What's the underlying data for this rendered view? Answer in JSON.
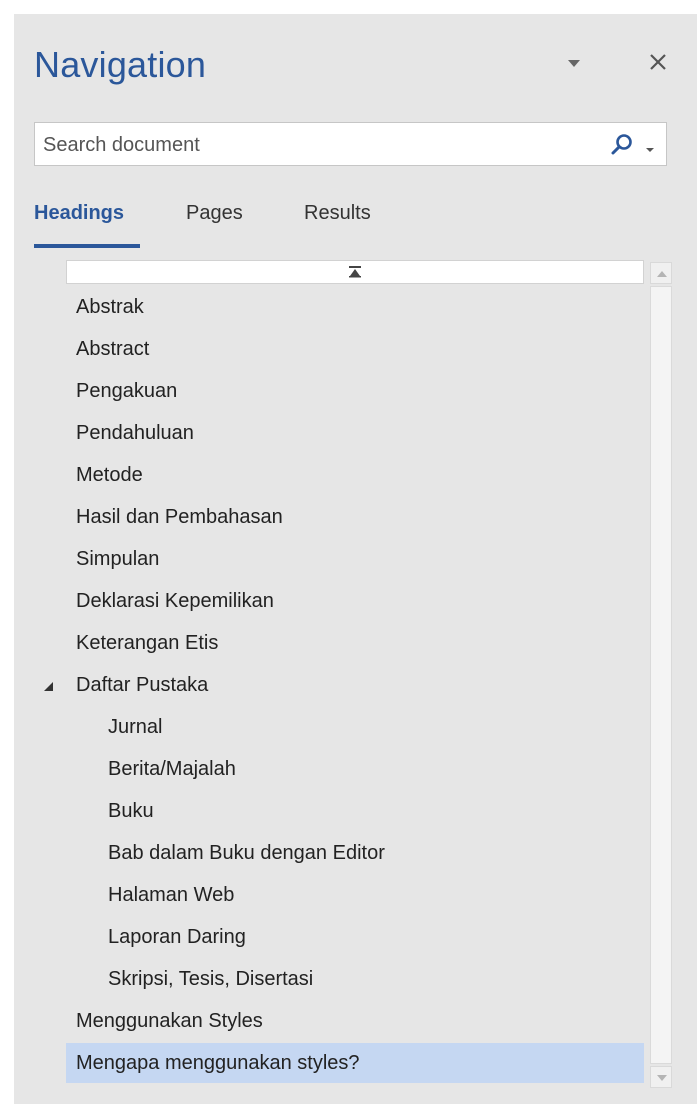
{
  "pane": {
    "title": "Navigation",
    "menu_icon": "chevron-down-icon",
    "close_icon": "close-icon",
    "accent_color": "#2b579a"
  },
  "search": {
    "placeholder": "Search document",
    "value": "",
    "icon": "search-icon",
    "dropdown_icon": "chevron-down-icon"
  },
  "tabs": [
    {
      "label": "Headings",
      "active": true
    },
    {
      "label": "Pages",
      "active": false
    },
    {
      "label": "Results",
      "active": false
    }
  ],
  "tree": {
    "collapse_all_icon": "collapse-to-top-icon",
    "selected_color": "#c5d7f2",
    "items": [
      {
        "label": "Abstrak",
        "level": 1
      },
      {
        "label": "Abstract",
        "level": 1
      },
      {
        "label": "Pengakuan",
        "level": 1
      },
      {
        "label": "Pendahuluan",
        "level": 1
      },
      {
        "label": "Metode",
        "level": 1
      },
      {
        "label": "Hasil dan Pembahasan",
        "level": 1
      },
      {
        "label": "Simpulan",
        "level": 1
      },
      {
        "label": "Deklarasi Kepemilikan",
        "level": 1
      },
      {
        "label": "Keterangan Etis",
        "level": 1
      },
      {
        "label": "Daftar Pustaka",
        "level": 1,
        "expanded": true
      },
      {
        "label": "Jurnal",
        "level": 2
      },
      {
        "label": "Berita/Majalah",
        "level": 2
      },
      {
        "label": "Buku",
        "level": 2
      },
      {
        "label": "Bab dalam Buku dengan Editor",
        "level": 2
      },
      {
        "label": "Halaman Web",
        "level": 2
      },
      {
        "label": "Laporan Daring",
        "level": 2
      },
      {
        "label": "Skripsi, Tesis, Disertasi",
        "level": 2
      },
      {
        "label": "Menggunakan Styles",
        "level": 1
      },
      {
        "label": "Mengapa menggunakan styles?",
        "level": 1,
        "selected": true
      }
    ]
  }
}
